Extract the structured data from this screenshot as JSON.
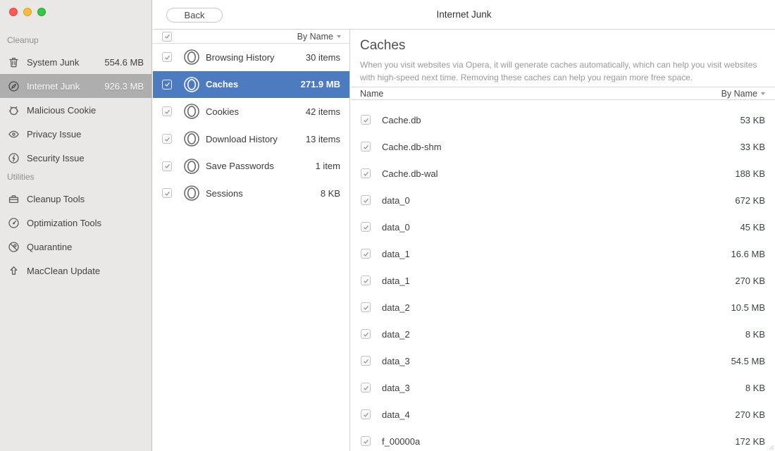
{
  "colors": {
    "accent": "#4c7bc0",
    "side-sel": "#aeaeae",
    "t-red": "#fc5b57",
    "t-yellow": "#fdbc40",
    "t-green": "#34c748"
  },
  "window": {
    "title": "Internet Junk"
  },
  "toolbar": {
    "back_label": "Back"
  },
  "sidebar": {
    "sections": [
      {
        "label": "Cleanup",
        "items": [
          {
            "icon": "trash-icon",
            "label": "System Junk",
            "value": "554.6 MB",
            "selected": false
          },
          {
            "icon": "compass-icon",
            "label": "Internet Junk",
            "value": "926.3 MB",
            "selected": true
          },
          {
            "icon": "bug-icon",
            "label": "Malicious Cookie",
            "value": "",
            "selected": false
          },
          {
            "icon": "eye-icon",
            "label": "Privacy Issue",
            "value": "",
            "selected": false
          },
          {
            "icon": "shield-bolt-icon",
            "label": "Security Issue",
            "value": "",
            "selected": false
          }
        ]
      },
      {
        "label": "Utilities",
        "items": [
          {
            "icon": "toolbox-icon",
            "label": "Cleanup Tools",
            "value": "",
            "selected": false
          },
          {
            "icon": "gauge-icon",
            "label": "Optimization Tools",
            "value": "",
            "selected": false
          },
          {
            "icon": "quarantine-icon",
            "label": "Quarantine",
            "value": "",
            "selected": false
          },
          {
            "icon": "arrow-up-icon",
            "label": "MacClean Update",
            "value": "",
            "selected": false
          }
        ]
      }
    ]
  },
  "category_list": {
    "select_all_checked": true,
    "sort_label": "By Name",
    "items": [
      {
        "icon": "opera-icon",
        "label": "Browsing History",
        "value": "30 items",
        "checked": true,
        "selected": false
      },
      {
        "icon": "opera-icon",
        "label": "Caches",
        "value": "271.9 MB",
        "checked": true,
        "selected": true
      },
      {
        "icon": "opera-icon",
        "label": "Cookies",
        "value": "42 items",
        "checked": true,
        "selected": false
      },
      {
        "icon": "opera-icon",
        "label": "Download History",
        "value": "13 items",
        "checked": true,
        "selected": false
      },
      {
        "icon": "opera-icon",
        "label": "Save Passwords",
        "value": "1 item",
        "checked": true,
        "selected": false
      },
      {
        "icon": "opera-icon",
        "label": "Sessions",
        "value": "8 KB",
        "checked": true,
        "selected": false
      }
    ]
  },
  "detail": {
    "heading": "Caches",
    "description": "When you visit websites via Opera, it will generate caches automatically, which can help you visit websites with high-speed next time. Removing these caches can help you regain more free space.",
    "table": {
      "name_header": "Name",
      "sort_label": "By Name",
      "rows": [
        {
          "name": "Cache.db",
          "size": "53 KB",
          "checked": true
        },
        {
          "name": "Cache.db-shm",
          "size": "33 KB",
          "checked": true
        },
        {
          "name": "Cache.db-wal",
          "size": "188 KB",
          "checked": true
        },
        {
          "name": "data_0",
          "size": "672 KB",
          "checked": true
        },
        {
          "name": "data_0",
          "size": "45 KB",
          "checked": true
        },
        {
          "name": "data_1",
          "size": "16.6 MB",
          "checked": true
        },
        {
          "name": "data_1",
          "size": "270 KB",
          "checked": true
        },
        {
          "name": "data_2",
          "size": "10.5 MB",
          "checked": true
        },
        {
          "name": "data_2",
          "size": "8 KB",
          "checked": true
        },
        {
          "name": "data_3",
          "size": "54.5 MB",
          "checked": true
        },
        {
          "name": "data_3",
          "size": "8 KB",
          "checked": true
        },
        {
          "name": "data_4",
          "size": "270 KB",
          "checked": true
        },
        {
          "name": "f_00000a",
          "size": "172 KB",
          "checked": true
        }
      ]
    }
  }
}
